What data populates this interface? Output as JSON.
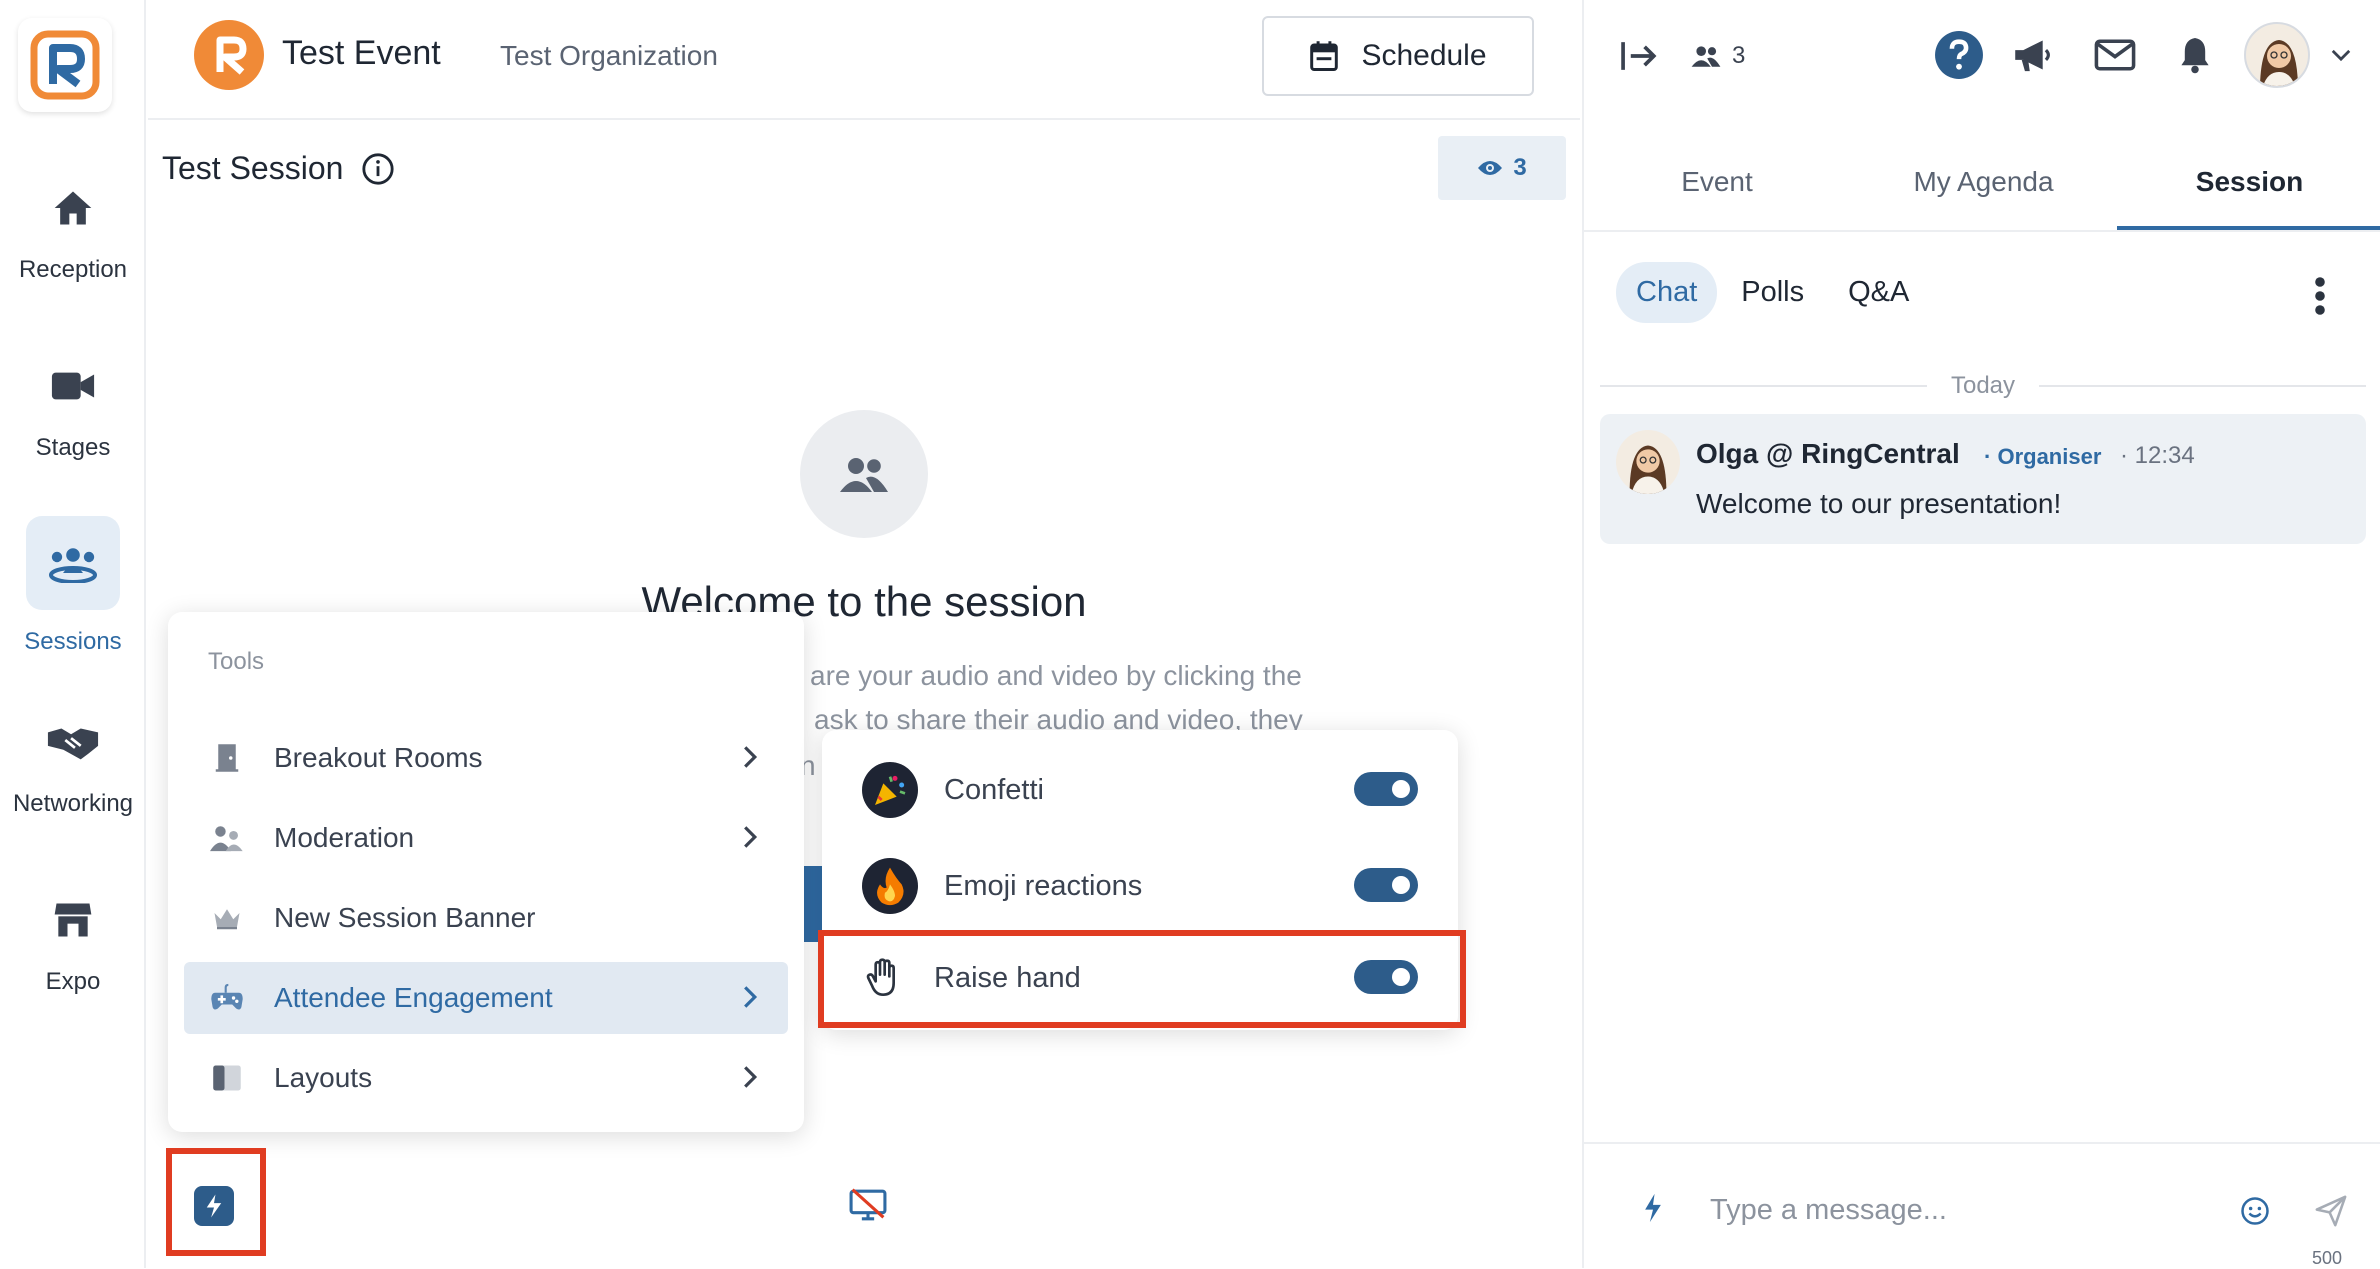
{
  "nav": {
    "items": [
      {
        "label": "Reception",
        "icon": "home-icon"
      },
      {
        "label": "Stages",
        "icon": "video-camera-icon"
      },
      {
        "label": "Sessions",
        "icon": "group-icon",
        "active": true
      },
      {
        "label": "Networking",
        "icon": "handshake-icon"
      },
      {
        "label": "Expo",
        "icon": "store-icon"
      }
    ]
  },
  "header": {
    "event_title": "Test Event",
    "organization": "Test Organization",
    "schedule_label": "Schedule"
  },
  "session": {
    "title": "Test Session",
    "viewer_count": "3",
    "welcome_heading": "Welcome to the session",
    "info_line1": "are your audio and video by clicking the",
    "info_line2": "ask to share their audio and video, they",
    "info_line3": "n"
  },
  "tools_menu": {
    "heading": "Tools",
    "items": [
      {
        "label": "Breakout Rooms",
        "icon": "door-icon"
      },
      {
        "label": "Moderation",
        "icon": "people-icon"
      },
      {
        "label": "New Session Banner",
        "icon": "crown-icon"
      },
      {
        "label": "Attendee Engagement",
        "icon": "gamepad-icon",
        "active": true
      },
      {
        "label": "Layouts",
        "icon": "layout-icon"
      }
    ]
  },
  "engagement_menu": {
    "items": [
      {
        "label": "Confetti",
        "icon": "party-popper-icon",
        "enabled": true
      },
      {
        "label": "Emoji reactions",
        "icon": "fire-emoji-icon",
        "enabled": true
      },
      {
        "label": "Raise hand",
        "icon": "raised-hand-icon",
        "enabled": true
      }
    ]
  },
  "right_panel": {
    "attendee_count": "3",
    "tabs": [
      "Event",
      "My Agenda",
      "Session"
    ],
    "active_tab": "Session",
    "subtabs": [
      "Chat",
      "Polls",
      "Q&A"
    ],
    "divider_label": "Today",
    "message": {
      "author": "Olga @ RingCentral",
      "role": "Organiser",
      "time": "12:34",
      "text": "Welcome to our presentation!"
    },
    "composer_placeholder": "Type a message...",
    "char_limit": "500"
  },
  "colors": {
    "accent": "#2f6aa3",
    "toggle": "#2d5c8a",
    "highlight": "#e03c21",
    "logo_orange": "#f08a37"
  }
}
